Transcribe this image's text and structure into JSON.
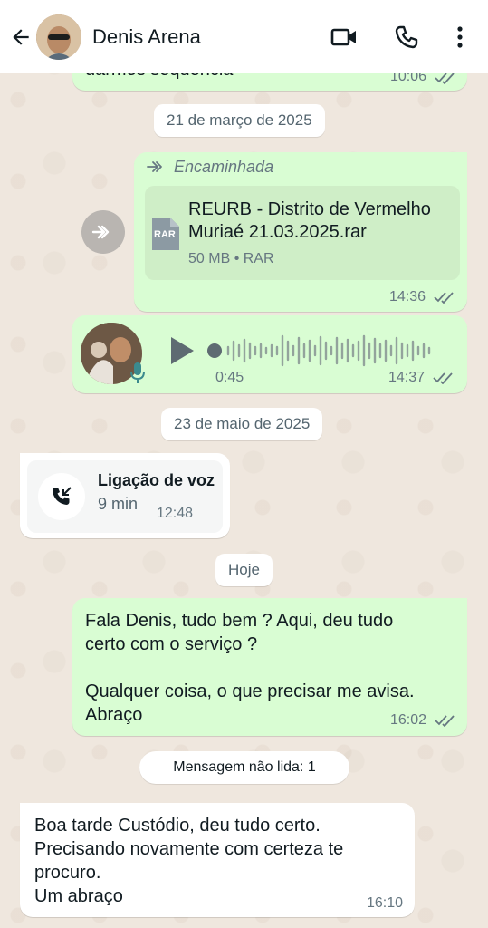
{
  "header": {
    "contact_name": "Denis Arena",
    "icons": [
      "back-arrow-icon",
      "video-call-icon",
      "voice-call-icon",
      "more-options-icon"
    ]
  },
  "messages": {
    "top_partial": {
      "text": "darmos sequência",
      "time": "10:06"
    },
    "date_1": "21 de março de 2025",
    "forwarded": {
      "label": "Encaminhada",
      "file_name_line1": "REURB - Distrito de Vermelho",
      "file_name_line2": "Muriaé 21.03.2025.rar",
      "file_meta": "50 MB • RAR",
      "file_type_badge": "RAR",
      "time": "14:36"
    },
    "voice_note": {
      "duration": "0:45",
      "time": "14:37"
    },
    "date_2": "23 de maio de 2025",
    "voice_call": {
      "title": "Ligação de voz",
      "duration": "9 min",
      "time": "12:48"
    },
    "date_3": "Hoje",
    "outgoing_today": {
      "text": "Fala Denis, tudo bem ? Aqui, deu tudo\ncerto com o serviço ?\n\nQualquer coisa, o que precisar me avisa.\nAbraço",
      "time": "16:02"
    },
    "unread_banner": "Mensagem não lida: 1",
    "incoming_today": {
      "text": "Boa tarde Custódio, deu tudo certo.\nPrecisando novamente com certeza te\nprocuro.\nUm abraço",
      "time": "16:10"
    }
  },
  "colors": {
    "outgoing_bubble": "#d9fdd3",
    "incoming_bubble": "#ffffff",
    "wallpaper": "#efe7de",
    "read_ticks": "#667781"
  }
}
